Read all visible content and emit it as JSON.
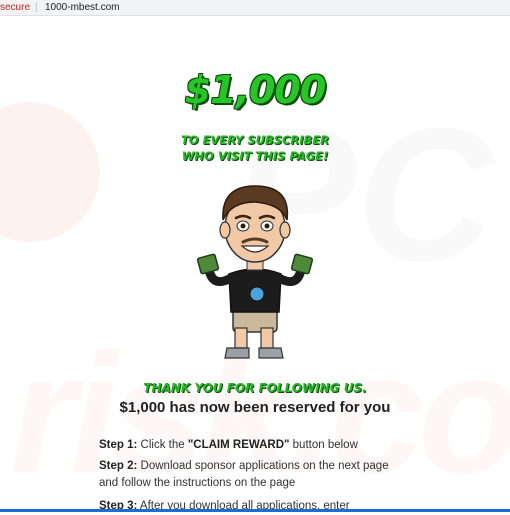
{
  "browser": {
    "security_label": "secure",
    "separator": "|",
    "url": "1000-mbest.com"
  },
  "hero": {
    "amount": "$1,000",
    "promo_line1": "TO EVERY SUBSCRIBER",
    "promo_line2": "WHO VISIT THIS PAGE!"
  },
  "thanks": "THANK YOU FOR FOLLOWING US.",
  "reserved": "$1,000 has now been reserved for you",
  "steps": [
    {
      "label": "Step 1:",
      "text_before": " Click the ",
      "highlight": "\"CLAIM REWARD\"",
      "text_after": " button below"
    },
    {
      "label": "Step 2:",
      "text": " Download sponsor applications on the next page and follow the instructions on the page"
    },
    {
      "label": "Step 3:",
      "text": " After you download all applications, enter"
    }
  ],
  "watermark": "risk.com",
  "colors": {
    "accent_green": "#2ab52a",
    "security_red": "#c5221f"
  }
}
